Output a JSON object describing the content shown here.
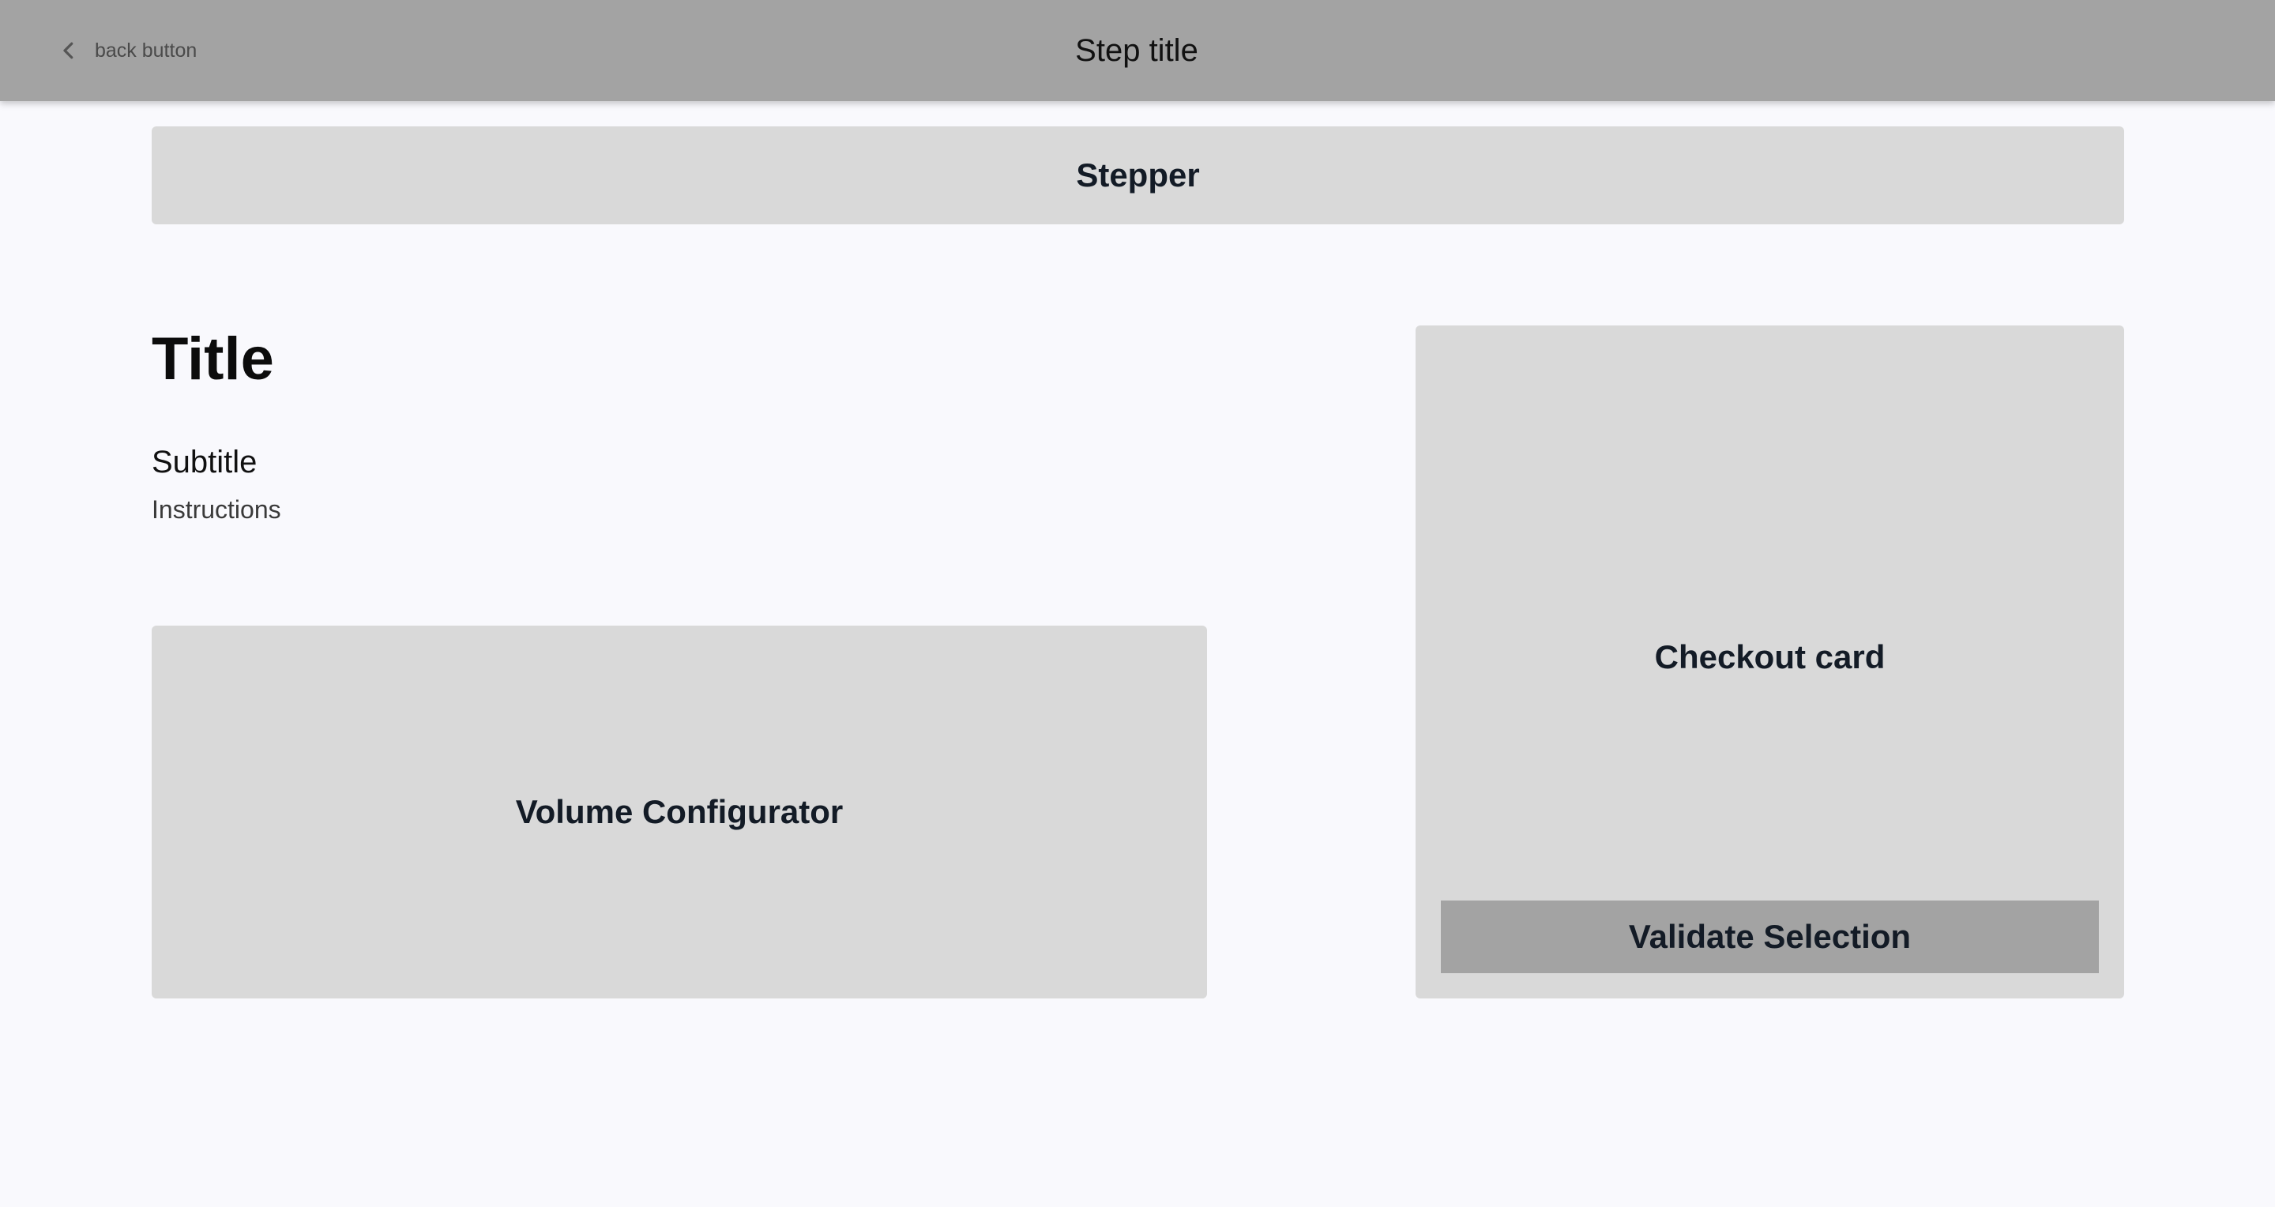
{
  "header": {
    "back_label": "back button",
    "back_icon": "chevron-left-icon",
    "step_title": "Step title"
  },
  "stepper": {
    "label": "Stepper"
  },
  "content": {
    "title": "Title",
    "subtitle": "Subtitle",
    "instructions": "Instructions"
  },
  "volume_configurator": {
    "label": "Volume Configurator"
  },
  "checkout_card": {
    "label": "Checkout card",
    "validate_label": "Validate Selection"
  },
  "colors": {
    "header_bg": "#a3a3a3",
    "page_bg": "#f9f9fd",
    "placeholder_bg": "#d9d9d9",
    "button_bg": "#a3a3a3",
    "placeholder_text": "#131b26"
  }
}
